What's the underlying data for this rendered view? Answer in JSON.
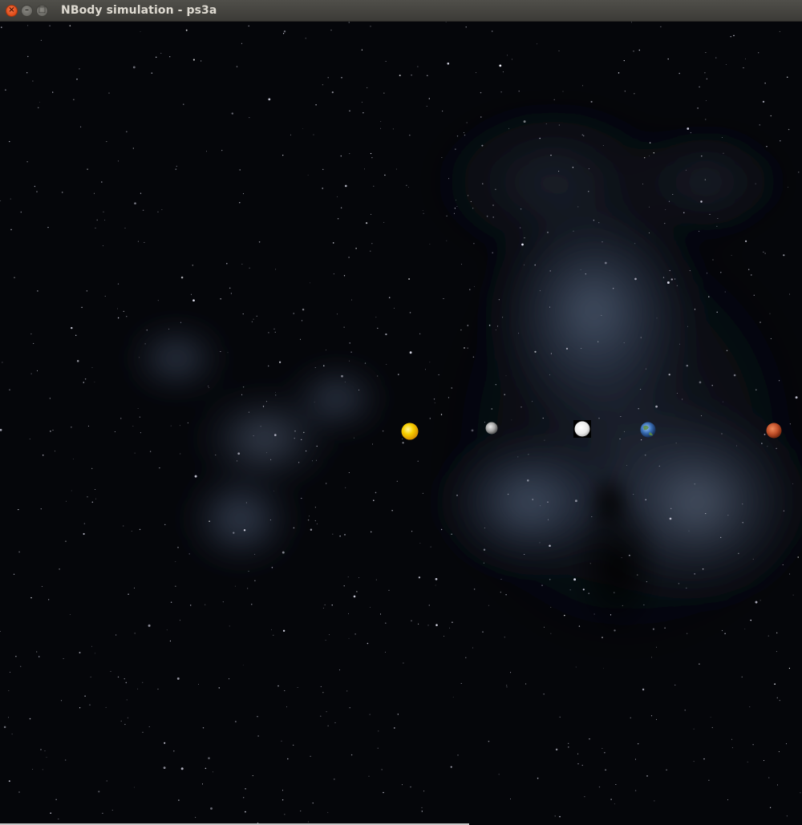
{
  "window": {
    "title": "NBody simulation - ps3a",
    "controls": {
      "close_icon": "close-icon",
      "minimize_icon": "minimize-icon",
      "maximize_icon": "maximize-icon"
    }
  },
  "scene": {
    "background": "space-nebula",
    "bodies": [
      {
        "name": "sun",
        "color": "#f5c400"
      },
      {
        "name": "mercury",
        "color": "#b8b8b8"
      },
      {
        "name": "venus",
        "color": "#f4f4f4"
      },
      {
        "name": "earth",
        "color": "#3a6fb5"
      },
      {
        "name": "mars",
        "color": "#c0502a"
      }
    ]
  }
}
